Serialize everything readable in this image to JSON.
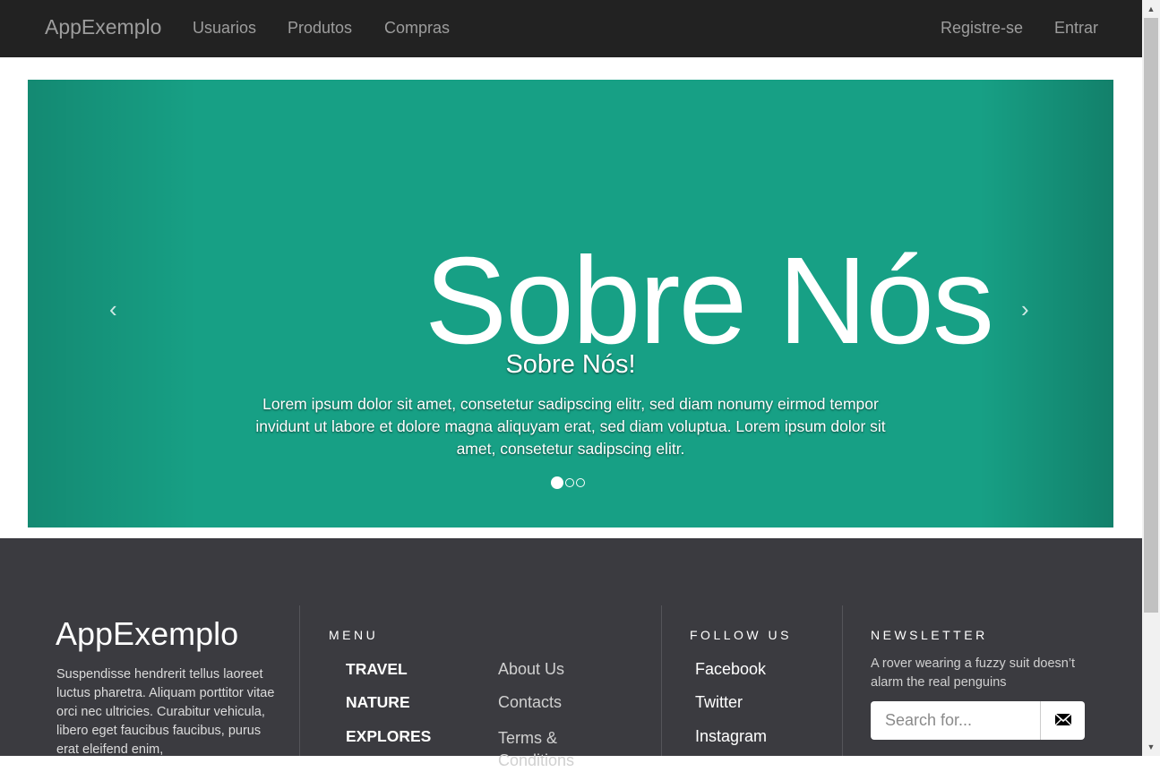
{
  "navbar": {
    "brand": "AppExemplo",
    "links": [
      "Usuarios",
      "Produtos",
      "Compras"
    ],
    "right_links": [
      "Registre-se",
      "Entrar"
    ]
  },
  "carousel": {
    "image_text": "Sobre Nós",
    "caption_title": "Sobre Nós!",
    "caption_text": "Lorem ipsum dolor sit amet, consetetur sadipscing elitr, sed diam nonumy eirmod tempor invidunt ut labore et dolore magna aliquyam erat, sed diam voluptua. Lorem ipsum dolor sit amet, consetetur sadipscing elitr.",
    "prev": "‹",
    "next": "›",
    "slide_count": 3,
    "active_slide": 1,
    "color": "#17a085"
  },
  "footer": {
    "brand": "AppExemplo",
    "description": "Suspendisse hendrerit tellus laoreet luctus pharetra. Aliquam porttitor vitae orci nec ultricies. Curabitur vehicula, libero eget faucibus faucibus, purus erat eleifend enim,",
    "menu": {
      "heading": "MENU",
      "categories": [
        "TRAVEL",
        "NATURE",
        "EXPLORES"
      ],
      "links": [
        "About Us",
        "Contacts",
        "Terms & Conditions"
      ]
    },
    "follow": {
      "heading": "FOLLOW US",
      "links": [
        "Facebook",
        "Twitter",
        "Instagram"
      ]
    },
    "newsletter": {
      "heading": "NEWSLETTER",
      "text": "A rover wearing a fuzzy suit doesn’t alarm the real penguins",
      "search_placeholder": "Search for...",
      "button_icon": "envelope-icon"
    },
    "background": "#3b3b40"
  }
}
